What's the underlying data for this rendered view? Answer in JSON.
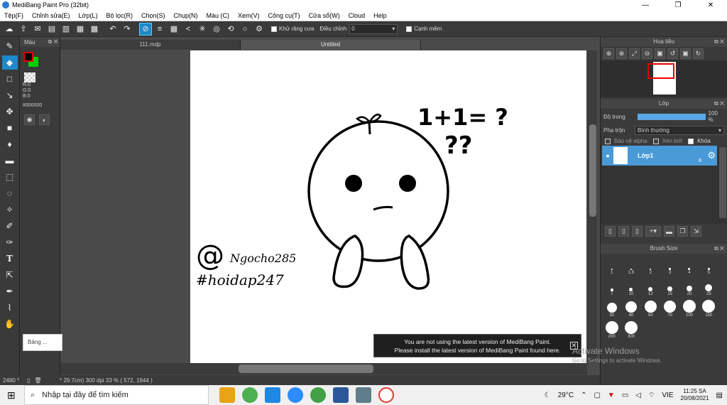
{
  "app": {
    "title": "MediBang Paint Pro (32bit)"
  },
  "window_controls": {
    "minimize": "—",
    "restore": "❐",
    "close": "✕"
  },
  "menu": [
    "Tệp(F)",
    "Chỉnh sửa(E)",
    "Lớp(L)",
    "Bộ lọc(R)",
    "Chọn(S)",
    "Chụp(N)",
    "Màu (C)",
    "Xem(V)",
    "Công cụ(T)",
    "Cửa sổ(W)",
    "Cloud",
    "Help"
  ],
  "toolbar": {
    "antialias_label": "Khử răng cưa",
    "adjust_label": "Điều chỉnh",
    "adjust_value": "0",
    "edge_label": "Cạnh mềm"
  },
  "color_panel": {
    "title": "Màu",
    "r": "R:0",
    "g": "G:0",
    "b": "B:0",
    "hex": "#000000",
    "primary_color": "#e00000",
    "secondary_color": "#00d000"
  },
  "tabs": [
    "111.mdp",
    "Untitled"
  ],
  "canvas": {
    "text_eq": "1+1= ?",
    "text_q": "??",
    "handle1": "@",
    "handle2": "Ngocho285",
    "hashtag": "#hoidap247"
  },
  "status": {
    "left": "2480 *",
    "coords": "* 29.7cm)  300 dpi  33 %  ( 572, 1944 )"
  },
  "popup": {
    "label": "Bảng ..."
  },
  "navigator": {
    "title": "Hoa tiêu"
  },
  "layer_panel": {
    "title": "Lớp",
    "opacity_label": "Độ trong",
    "opacity_value": "100 %",
    "opacity_fraction": 1.0,
    "blend_label": "Pha trộn",
    "blend_value": "Bình thường",
    "protect_alpha": "Bảo vệ alpha",
    "clipping": "Xén bớt",
    "lock": "Khóa",
    "layer_name": "Lớp1",
    "layer_bits": "8"
  },
  "brush_size": {
    "title": "Brush Size",
    "sizes": [
      "1",
      "1.5",
      "2",
      "3",
      "4",
      "5",
      "7",
      "10",
      "12",
      "15",
      "20",
      "25",
      "30",
      "40",
      "50",
      "70",
      "100",
      "150",
      "200",
      "300"
    ]
  },
  "notification": {
    "line1": "You are not using the latest version of MediBang Paint.",
    "line2": "Please install the latest version of MediBang Paint found here."
  },
  "watermark": {
    "line1": "Activate Windows",
    "line2": "Go to Settings to activate Windows."
  },
  "taskbar": {
    "search_placeholder": "Nhập tại đây để tìm kiếm",
    "temperature": "29°C",
    "language": "VIE",
    "time": "11:25 SA",
    "date": "20/08/2021"
  }
}
